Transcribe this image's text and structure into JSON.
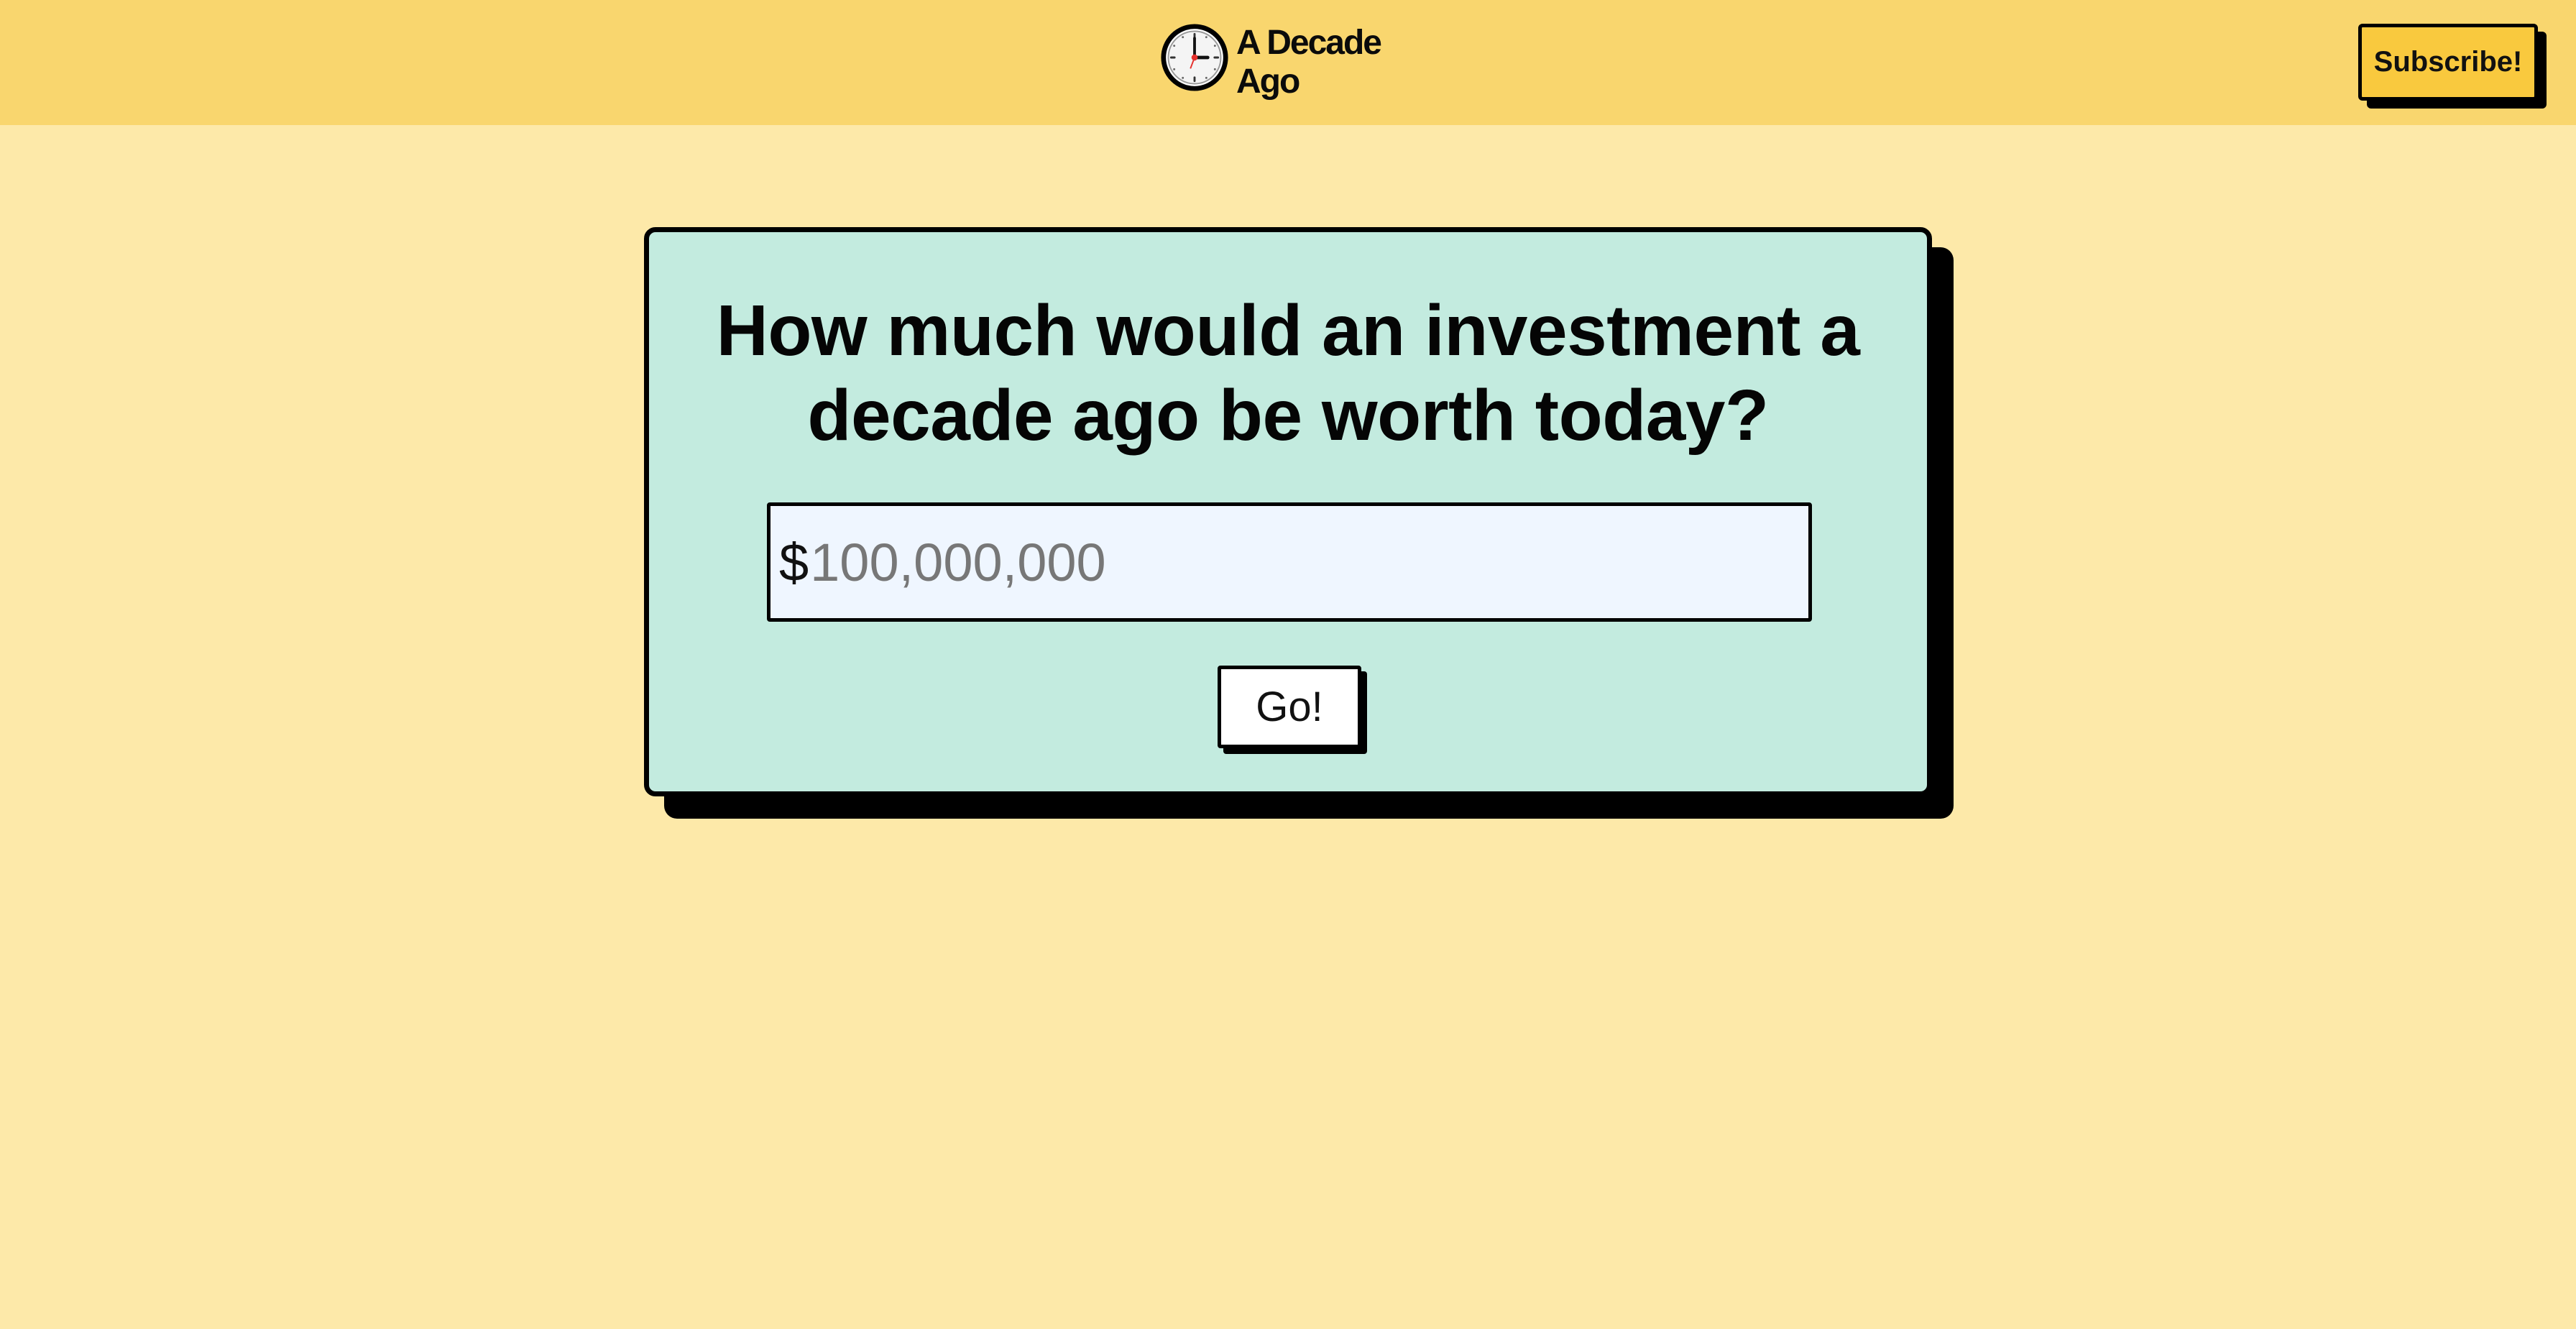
{
  "header": {
    "logo_icon": "clock-icon",
    "logo_line1": "A Decade",
    "logo_line2": "Ago",
    "subscribe_label": "Subscribe!"
  },
  "main": {
    "headline_line1": "How much would an investment a",
    "headline_line2": "decade ago be worth today?",
    "currency_symbol": "$",
    "amount_value": "",
    "amount_placeholder": "100,000,000",
    "go_label": "Go!"
  },
  "colors": {
    "page_background": "#fde9a9",
    "header_background": "#f9d66e",
    "card_background": "#c3ebdf",
    "input_background": "#eff6ff",
    "subscribe_background": "#f9c93e",
    "clock_hand_accent": "#e5302c"
  }
}
